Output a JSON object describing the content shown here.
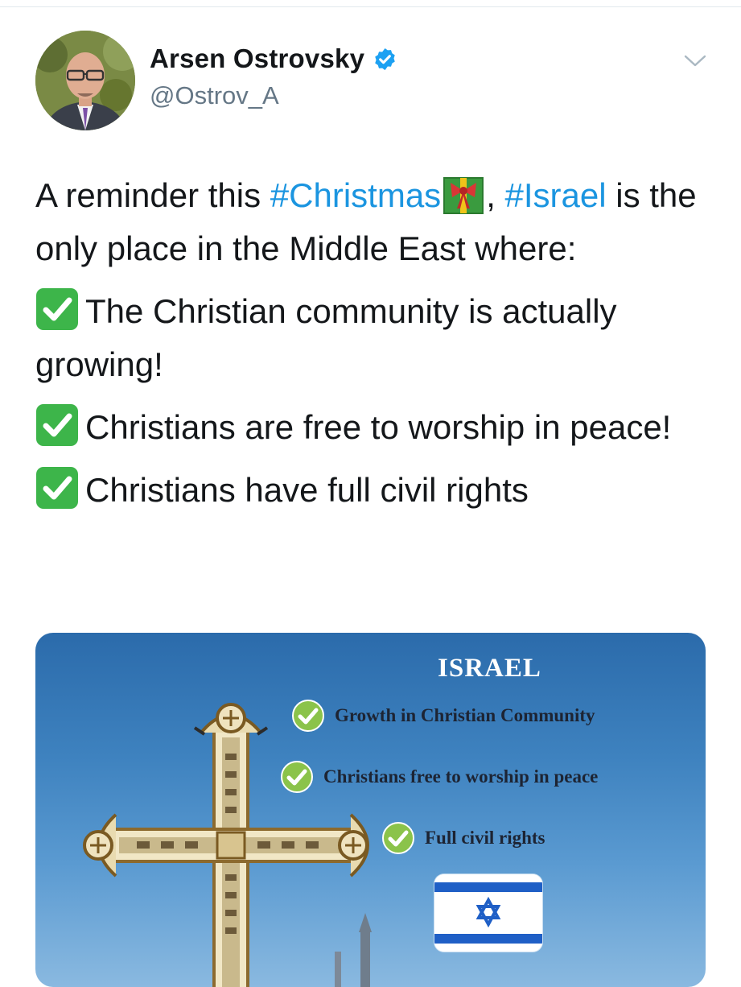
{
  "tweet": {
    "author": {
      "display_name": "Arsen Ostrovsky",
      "handle": "@Ostrov_A",
      "verified": true,
      "avatar_icon": "user-photo-avatar"
    },
    "menu_icon": "chevron-down-icon",
    "text": {
      "intro_prefix": "A reminder this ",
      "hashtag_christmas": "#Christmas",
      "gift_emoji_icon": "wrapped-gift-emoji",
      "comma": ", ",
      "hashtag_israel": "#Israel",
      "intro_suffix": " is the only place in the Middle East where:",
      "check_emoji_icon": "white-heavy-check-mark-emoji",
      "points": [
        "The Christian community is actually growing!",
        "Christians are free to worship in peace!",
        "Christians have full civil rights"
      ]
    },
    "media": {
      "title": "ISRAEL",
      "items": [
        "Growth in Christian Community",
        "Christians free to worship in peace",
        "Full civil rights"
      ],
      "cross_icon": "ornate-cross-image",
      "flag_icon": "israel-flag-icon"
    }
  },
  "colors": {
    "hashtag": "#1b95e0",
    "verified": "#1da1f2",
    "handle": "#657786",
    "check_emoji": "#3db54a",
    "image_check": "#7cb342",
    "flag_blue": "#1f5fc6"
  }
}
